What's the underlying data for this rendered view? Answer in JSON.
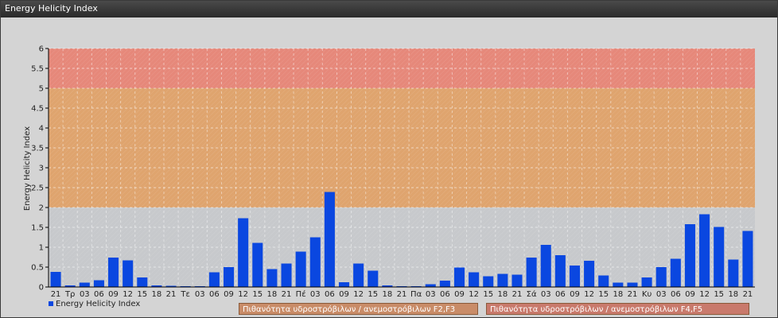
{
  "window": {
    "title": "Energy Helicity Index"
  },
  "colors": {
    "bar": "#0a47e0",
    "band_low": "#c7c9cc",
    "band_mid": "#dfa46e",
    "band_high": "#e6887a",
    "panel": "#d4d4d4"
  },
  "legend": {
    "series_label": "Energy Helicity Index",
    "band_f2f3": "Πιθανότητα υδροστρόβιλων / ανεμοστρόβιλων F2,F3",
    "band_f4f5": "Πιθανότητα υδροστρόβιλων / ανεμοστρόβιλων F4,F5"
  },
  "chart_data": {
    "type": "bar",
    "ylabel": "Energy Helicity Index",
    "ylim": [
      0,
      6
    ],
    "yticks": [
      "0",
      "0.5",
      "1",
      "1.5",
      "2",
      "2.5",
      "3",
      "3.5",
      "4",
      "4.5",
      "5",
      "5.5",
      "6"
    ],
    "grid": true,
    "bands": [
      {
        "from": 0,
        "to": 2,
        "color": "#c7c9cc"
      },
      {
        "from": 2,
        "to": 5,
        "color": "#dfa46e"
      },
      {
        "from": 5,
        "to": 6,
        "color": "#e6887a"
      }
    ],
    "categories": [
      "21",
      "Τρ",
      "03",
      "06",
      "09",
      "12",
      "15",
      "18",
      "21",
      "Τε",
      "03",
      "06",
      "09",
      "12",
      "15",
      "18",
      "21",
      "Πέ",
      "03",
      "06",
      "09",
      "12",
      "15",
      "18",
      "21",
      "Πα",
      "03",
      "06",
      "09",
      "12",
      "15",
      "18",
      "21",
      "Σά",
      "03",
      "06",
      "09",
      "12",
      "15",
      "18",
      "21",
      "Κυ",
      "03",
      "06",
      "09",
      "12",
      "15",
      "18",
      "21"
    ],
    "series": [
      {
        "name": "Energy Helicity Index",
        "values": [
          0.38,
          0.04,
          0.11,
          0.17,
          0.74,
          0.67,
          0.24,
          0.04,
          0.03,
          0.02,
          0.02,
          0.37,
          0.5,
          1.73,
          1.11,
          0.45,
          0.59,
          0.89,
          1.25,
          2.39,
          0.12,
          0.59,
          0.41,
          0.04,
          0.02,
          0.02,
          0.07,
          0.16,
          0.49,
          0.37,
          0.27,
          0.33,
          0.31,
          0.74,
          1.06,
          0.8,
          0.54,
          0.66,
          0.29,
          0.11,
          0.11,
          0.24,
          0.5,
          0.71,
          1.58,
          1.83,
          1.51,
          0.69,
          1.41
        ]
      }
    ]
  }
}
